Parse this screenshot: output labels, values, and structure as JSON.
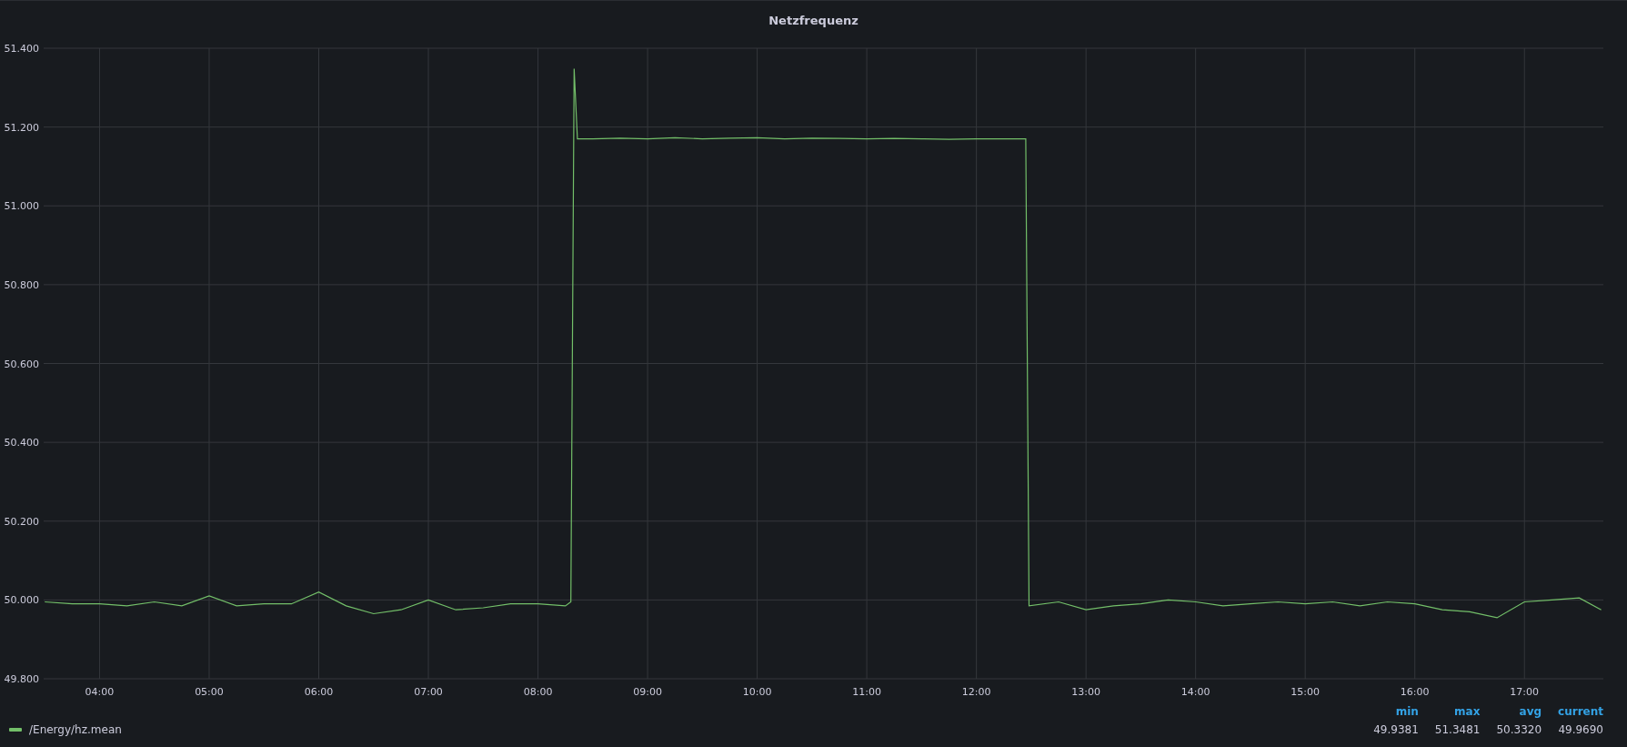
{
  "panel": {
    "title": "Netzfrequenz",
    "chart_data": {
      "type": "line",
      "x": [
        3.5,
        3.75,
        4.0,
        4.25,
        4.5,
        4.75,
        5.0,
        5.25,
        5.5,
        5.75,
        6.0,
        6.25,
        6.5,
        6.75,
        7.0,
        7.25,
        7.5,
        7.75,
        8.0,
        8.25,
        8.3,
        8.33,
        8.36,
        8.5,
        8.75,
        9.0,
        9.25,
        9.5,
        9.75,
        10.0,
        10.25,
        10.5,
        10.75,
        11.0,
        11.25,
        11.5,
        11.75,
        12.0,
        12.25,
        12.45,
        12.48,
        12.75,
        13.0,
        13.25,
        13.5,
        13.75,
        14.0,
        14.25,
        14.5,
        14.75,
        15.0,
        15.25,
        15.5,
        15.75,
        16.0,
        16.25,
        16.5,
        16.75,
        17.0,
        17.25,
        17.5,
        17.7
      ],
      "series": [
        {
          "name": "/Energy/hz.mean",
          "color": "#73bf69",
          "values": [
            49.995,
            49.99,
            49.99,
            49.985,
            49.995,
            49.985,
            50.01,
            49.985,
            49.99,
            49.99,
            50.02,
            49.985,
            49.965,
            49.975,
            50.0,
            49.975,
            49.98,
            49.99,
            49.99,
            49.985,
            49.995,
            51.348,
            51.17,
            51.17,
            51.172,
            51.17,
            51.173,
            51.17,
            51.172,
            51.173,
            51.17,
            51.172,
            51.171,
            51.17,
            51.171,
            51.17,
            51.169,
            51.17,
            51.17,
            51.17,
            49.985,
            49.995,
            49.975,
            49.985,
            49.99,
            50.0,
            49.995,
            49.985,
            49.99,
            49.995,
            49.99,
            49.995,
            49.985,
            49.995,
            49.99,
            49.975,
            49.97,
            49.955,
            49.995,
            50.0,
            50.005,
            49.975
          ]
        }
      ],
      "grid": true,
      "xlim": [
        3.49,
        17.72
      ],
      "ylim": [
        49.8,
        51.4
      ],
      "xticks": [
        {
          "value": 4,
          "label": "04:00"
        },
        {
          "value": 5,
          "label": "05:00"
        },
        {
          "value": 6,
          "label": "06:00"
        },
        {
          "value": 7,
          "label": "07:00"
        },
        {
          "value": 8,
          "label": "08:00"
        },
        {
          "value": 9,
          "label": "09:00"
        },
        {
          "value": 10,
          "label": "10:00"
        },
        {
          "value": 11,
          "label": "11:00"
        },
        {
          "value": 12,
          "label": "12:00"
        },
        {
          "value": 13,
          "label": "13:00"
        },
        {
          "value": 14,
          "label": "14:00"
        },
        {
          "value": 15,
          "label": "15:00"
        },
        {
          "value": 16,
          "label": "16:00"
        },
        {
          "value": 17,
          "label": "17:00"
        }
      ],
      "yticks": [
        {
          "value": 49.8,
          "label": "49.800"
        },
        {
          "value": 50.0,
          "label": "50.000"
        },
        {
          "value": 50.2,
          "label": "50.200"
        },
        {
          "value": 50.4,
          "label": "50.400"
        },
        {
          "value": 50.6,
          "label": "50.600"
        },
        {
          "value": 50.8,
          "label": "50.800"
        },
        {
          "value": 51.0,
          "label": "51.000"
        },
        {
          "value": 51.2,
          "label": "51.200"
        },
        {
          "value": 51.4,
          "label": "51.400"
        }
      ]
    },
    "legend": {
      "columns": [
        "min",
        "max",
        "avg",
        "current"
      ],
      "rows": [
        {
          "values": [
            "49.9381",
            "51.3481",
            "50.3320",
            "49.9690"
          ]
        }
      ]
    }
  }
}
